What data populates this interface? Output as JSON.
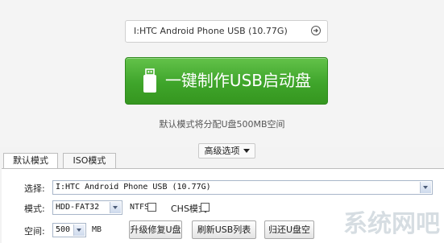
{
  "top": {
    "device_value": "I:HTC Android Phone USB (10.77G)",
    "make_button_label": "一键制作USB启动盘",
    "hint": "默认模式将分配U盘500MB空间"
  },
  "advanced": {
    "label": "高级选项"
  },
  "tabs": [
    {
      "label": "默认模式"
    },
    {
      "label": "ISO模式"
    }
  ],
  "form": {
    "select_label": "选择:",
    "select_value": "I:HTC Android Phone USB (10.77G)",
    "mode_label": "模式:",
    "mode_value": "HDD-FAT32",
    "ntfs_label": "NTFS",
    "chs_label": "CHS模式",
    "ntfs_checked": false,
    "chs_checked": false,
    "space_label": "空间:",
    "space_value": "500",
    "space_unit": "MB"
  },
  "buttons": {
    "upgrade": "升级修复U盘",
    "refresh": "刷新USB列表",
    "restore": "归还U盘空间"
  },
  "watermark": {
    "text": "系统网吧"
  },
  "colors": {
    "accent_green": "#3fa52b"
  },
  "icons": {
    "go": "arrow-circle-right-icon",
    "usb": "usb-drive-icon"
  }
}
